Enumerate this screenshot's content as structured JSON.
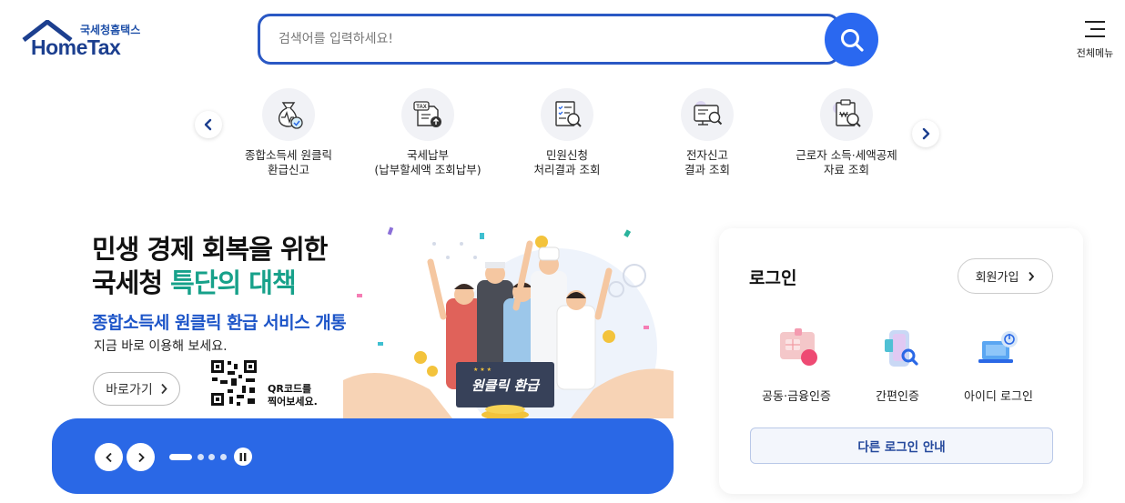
{
  "header": {
    "logo_sub": "국세청홈택스",
    "logo_main": "HomeTax",
    "search_placeholder": "검색어를 입력하세요!",
    "search_icon": "search-icon",
    "menu_label": "전체메뉴",
    "menu_icon": "hamburger-icon"
  },
  "quick_menu": {
    "items": [
      {
        "line1": "종합소득세 원클릭",
        "line2": "환급신고",
        "icon": "refund-bag-icon"
      },
      {
        "line1": "국세납부",
        "line2": "(납부할세액 조회납부)",
        "icon": "tax-document-icon"
      },
      {
        "line1": "민원신청",
        "line2": "처리결과 조회",
        "icon": "checklist-search-icon"
      },
      {
        "line1": "전자신고",
        "line2": "결과 조회",
        "icon": "computer-search-icon"
      },
      {
        "line1": "근로자 소득·세액공제",
        "line2": "자료 조회",
        "icon": "receipt-search-icon"
      }
    ]
  },
  "banner": {
    "headline_line1": "민생 경제 회복을 위한",
    "headline_line2_a": "국세청 ",
    "headline_line2_b": "특단의 대책",
    "subheadline": "종합소득세 원클릭 환급 서비스 개통",
    "description": "지금 바로 이용해 보세요.",
    "go_button": "바로가기",
    "qr_line1": "QR코드를",
    "qr_line2": "찍어보세요.",
    "sign_text": "원클릭 환급",
    "accent_colors": {
      "teal": "#17a18a",
      "blue": "#1d55c8"
    }
  },
  "slider": {
    "bar_color": "#2a68e6",
    "prev_icon": "chevron-left-icon",
    "next_icon": "chevron-right-icon",
    "pause_icon": "pause-icon",
    "page_count": 4,
    "active_page": 1
  },
  "login": {
    "title": "로그인",
    "join_button": "회원가입",
    "options": [
      {
        "label": "공동·금융인증",
        "icon": "certificate-icon"
      },
      {
        "label": "간편인증",
        "icon": "phone-auth-icon"
      },
      {
        "label": "아이디 로그인",
        "icon": "laptop-id-icon"
      }
    ],
    "other_button": "다른 로그인 안내"
  }
}
